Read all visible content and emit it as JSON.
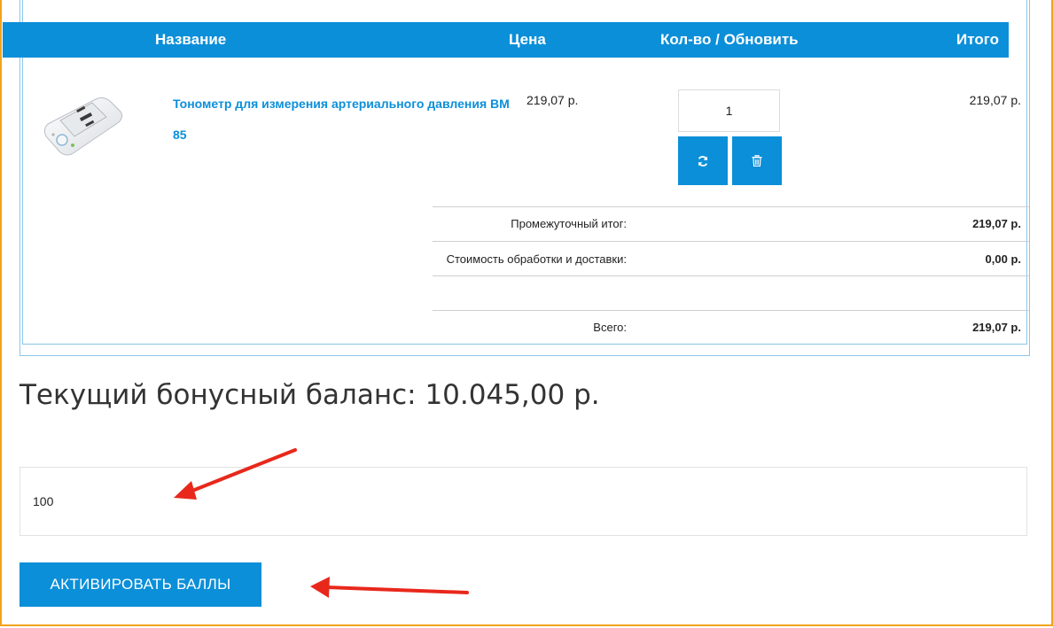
{
  "cart": {
    "headers": {
      "name": "Название",
      "price": "Цена",
      "qty": "Кол-во / Обновить",
      "total": "Итого"
    },
    "item": {
      "name": "Тонометр для измерения артериального давления BM 85",
      "price": "219,07 р.",
      "qty": "1",
      "total": "219,07 р.",
      "image_icon": "blood-pressure-monitor-image"
    },
    "actions": {
      "refresh_icon": "refresh-icon",
      "delete_icon": "trash-icon"
    },
    "summary": {
      "subtotal_label": "Промежуточный итог:",
      "subtotal_value": "219,07 р.",
      "shipping_label": "Стоимость обработки и доставки:",
      "shipping_value": "0,00 р.",
      "grand_label": "Всего:",
      "grand_value": "219,07 р."
    }
  },
  "bonus": {
    "title": "Текущий бонусный баланс: 10.045,00 р.",
    "input_value": "100",
    "activate_label": "АКТИВИРОВАТЬ БАЛЛЫ"
  },
  "colors": {
    "accent": "#0b8fd9",
    "frame": "#f2a31b",
    "annotation_arrow": "#e8281b"
  }
}
